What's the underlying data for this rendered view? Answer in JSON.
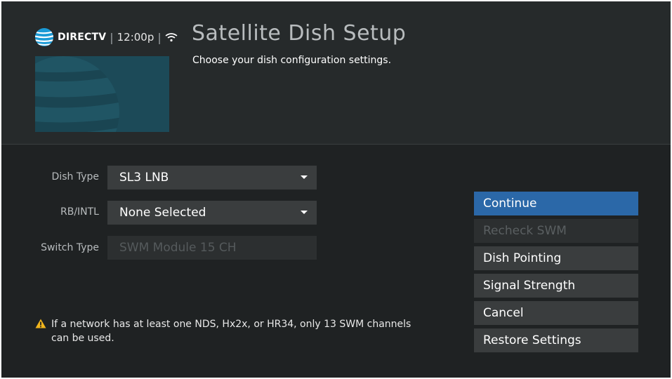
{
  "header": {
    "brand": "DIRECTV",
    "time": "12:00p",
    "title": "Satellite Dish Setup",
    "subtitle": "Choose your dish configuration settings."
  },
  "form": {
    "dish_type": {
      "label": "Dish Type",
      "value": "SL3 LNB"
    },
    "rb_intl": {
      "label": "RB/INTL",
      "value": "None Selected"
    },
    "switch_type": {
      "label": "Switch Type",
      "value": "SWM Module 15 CH"
    }
  },
  "warning": {
    "text": "If a network has at least one NDS, Hx2x, or HR34, only 13 SWM channels can be used."
  },
  "menu": {
    "continue": "Continue",
    "recheck_swm": "Recheck SWM",
    "dish_pointing": "Dish Pointing",
    "signal_strength": "Signal Strength",
    "cancel": "Cancel",
    "restore_settings": "Restore Settings"
  },
  "colors": {
    "background": "#1f2223",
    "header_background": "#262a2b",
    "selected_button": "#2b68a8",
    "button": "#3a3d3e",
    "brand_blue": "#1a9ad6",
    "warning_yellow": "#f1b51c"
  },
  "icons": [
    "att-globe-icon",
    "wifi-icon",
    "chevron-down-icon",
    "warning-icon"
  ]
}
